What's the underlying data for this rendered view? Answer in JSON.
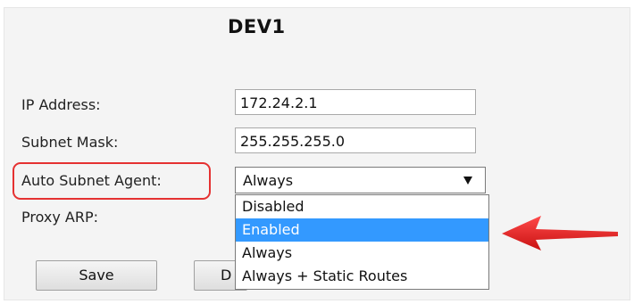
{
  "device": {
    "title": "DEV1"
  },
  "form": {
    "ip_label": "IP Address:",
    "ip_value": "172.24.2.1",
    "mask_label": "Subnet Mask:",
    "mask_value": "255.255.255.0",
    "agent_label": "Auto Subnet Agent:",
    "agent_selected": "Always",
    "agent_options": [
      "Disabled",
      "Enabled",
      "Always",
      "Always + Static Routes"
    ],
    "agent_highlighted_option": "Enabled",
    "proxy_label": "Proxy ARP:"
  },
  "buttons": {
    "save_label": "Save",
    "second_label_visible": "D"
  },
  "annotations": {
    "highlight_color": "#e53131",
    "arrow_color": "#e31b1b"
  },
  "icons": {
    "dropdown_arrow": "chevron-down-icon",
    "pointer_arrow": "arrow-left-icon"
  }
}
